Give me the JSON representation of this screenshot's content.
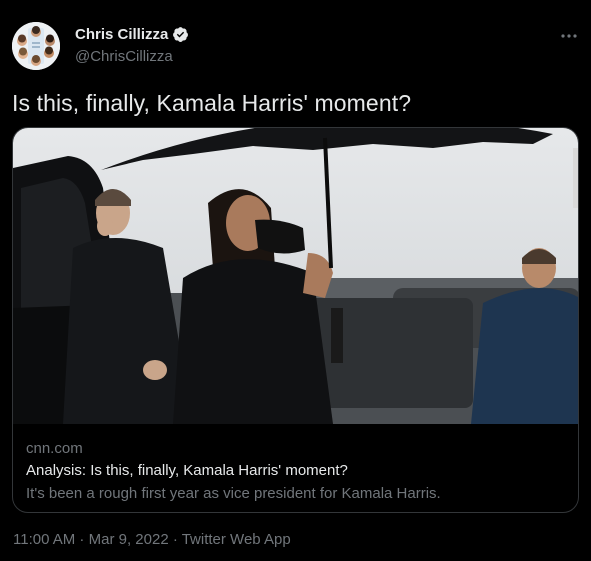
{
  "author": {
    "display_name": "Chris Cillizza",
    "handle": "@ChrisCillizza",
    "verified": true
  },
  "tweet": {
    "text": "Is this, finally, Kamala Harris' moment?"
  },
  "card": {
    "image_icon": "photo-umbrella-woman-in-mask",
    "domain": "cnn.com",
    "title": "Analysis: Is this, finally, Kamala Harris' moment?",
    "description": "It's been a rough first year as vice president for Kamala Harris."
  },
  "meta": {
    "time": "11:00 AM",
    "separator": " · ",
    "date": "Mar 9, 2022",
    "source": "Twitter Web App"
  },
  "colors": {
    "background": "#000000",
    "text_primary": "#e7e9ea",
    "text_secondary": "#71767b",
    "border": "#333639",
    "verified_badge": "#e7e9ea"
  },
  "icons": {
    "more": "more-horizontal-icon",
    "verified": "verified-badge-icon"
  }
}
